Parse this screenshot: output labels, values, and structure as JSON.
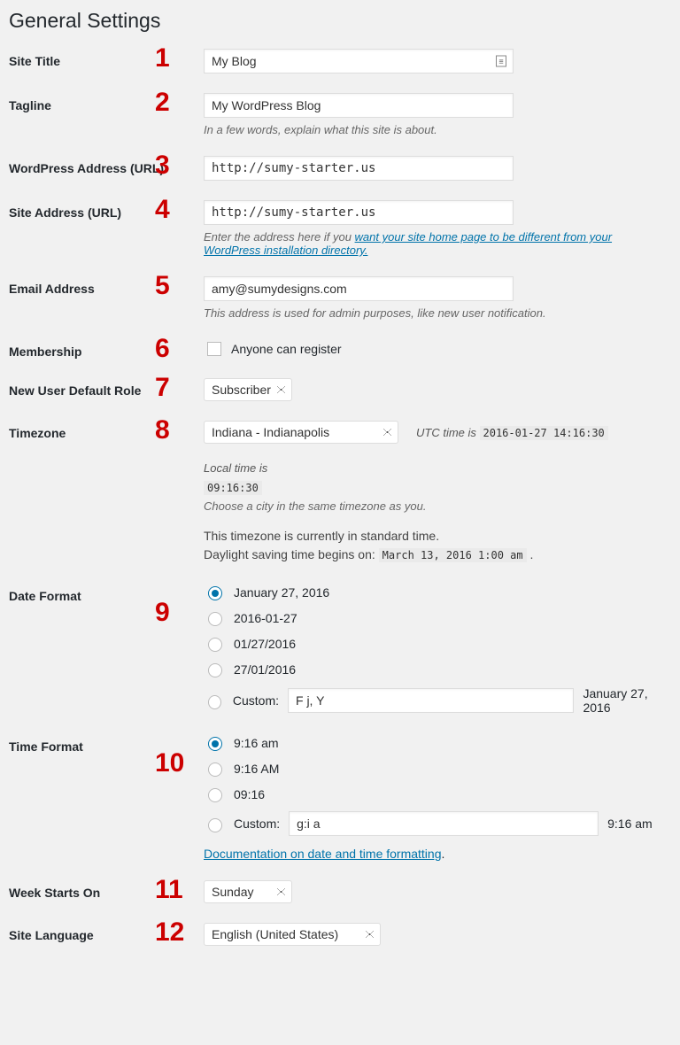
{
  "page_title": "General Settings",
  "annotations": [
    "1",
    "2",
    "3",
    "4",
    "5",
    "6",
    "7",
    "8",
    "9",
    "10",
    "11",
    "12"
  ],
  "site_title": {
    "label": "Site Title",
    "value": "My Blog"
  },
  "tagline": {
    "label": "Tagline",
    "value": "My WordPress Blog",
    "desc": "In a few words, explain what this site is about."
  },
  "wp_address": {
    "label": "WordPress Address (URL)",
    "value": "http://sumy-starter.us"
  },
  "site_address": {
    "label": "Site Address (URL)",
    "value": "http://sumy-starter.us",
    "desc_prefix": "Enter the address here if you ",
    "desc_link": "want your site home page to be different from your WordPress installation directory."
  },
  "email": {
    "label": "Email Address",
    "value": "amy@sumydesigns.com",
    "desc": "This address is used for admin purposes, like new user notification."
  },
  "membership": {
    "label": "Membership",
    "checkbox_label": "Anyone can register"
  },
  "default_role": {
    "label": "New User Default Role",
    "value": "Subscriber"
  },
  "timezone": {
    "label": "Timezone",
    "value": "Indiana - Indianapolis",
    "utc_label": "UTC time is ",
    "utc_value": "2016-01-27 14:16:30",
    "local_label": "Local time is ",
    "local_value": "09:16:30",
    "desc": "Choose a city in the same timezone as you.",
    "std_line": "This timezone is currently in standard time.",
    "dst_prefix": "Daylight saving time begins on: ",
    "dst_value": "March 13, 2016 1:00 am"
  },
  "date_format": {
    "label": "Date Format",
    "options": [
      "January 27, 2016",
      "2016-01-27",
      "01/27/2016",
      "27/01/2016"
    ],
    "custom_label": "Custom:",
    "custom_value": "F j, Y",
    "custom_preview": "January 27, 2016"
  },
  "time_format": {
    "label": "Time Format",
    "options": [
      "9:16 am",
      "9:16 AM",
      "09:16"
    ],
    "custom_label": "Custom:",
    "custom_value": "g:i a",
    "custom_preview": "9:16 am",
    "doc_link": "Documentation on date and time formatting"
  },
  "week_starts": {
    "label": "Week Starts On",
    "value": "Sunday"
  },
  "site_language": {
    "label": "Site Language",
    "value": "English (United States)"
  }
}
